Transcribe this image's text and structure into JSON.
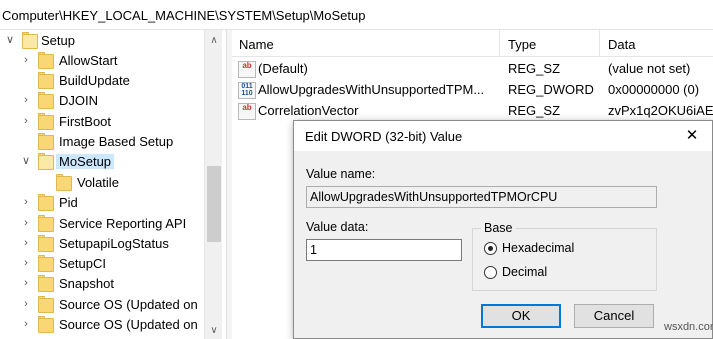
{
  "address": {
    "path": "Computer\\HKEY_LOCAL_MACHINE\\SYSTEM\\Setup\\MoSetup"
  },
  "tree": {
    "items": [
      {
        "label": "Setup",
        "arrow": "∨",
        "open": true,
        "selected": false
      },
      {
        "label": "AllowStart",
        "arrow": "›",
        "open": false,
        "selected": false
      },
      {
        "label": "BuildUpdate",
        "arrow": "",
        "open": false,
        "selected": false
      },
      {
        "label": "DJOIN",
        "arrow": "›",
        "open": false,
        "selected": false
      },
      {
        "label": "FirstBoot",
        "arrow": "›",
        "open": false,
        "selected": false
      },
      {
        "label": "Image Based Setup",
        "arrow": "",
        "open": false,
        "selected": false
      },
      {
        "label": "MoSetup",
        "arrow": "∨",
        "open": true,
        "selected": true
      },
      {
        "label": "Volatile",
        "arrow": "",
        "open": false,
        "selected": false
      },
      {
        "label": "Pid",
        "arrow": "›",
        "open": false,
        "selected": false
      },
      {
        "label": "Service Reporting API",
        "arrow": "›",
        "open": false,
        "selected": false
      },
      {
        "label": "SetupapiLogStatus",
        "arrow": "›",
        "open": false,
        "selected": false
      },
      {
        "label": "SetupCI",
        "arrow": "›",
        "open": false,
        "selected": false
      },
      {
        "label": "Snapshot",
        "arrow": "›",
        "open": false,
        "selected": false
      },
      {
        "label": "Source OS (Updated on",
        "arrow": "›",
        "open": false,
        "selected": false
      },
      {
        "label": "Source OS (Updated on",
        "arrow": "›",
        "open": false,
        "selected": false
      }
    ],
    "scroll_up": "∧",
    "scroll_down": "∨"
  },
  "list": {
    "headers": {
      "name": "Name",
      "type": "Type",
      "data": "Data"
    },
    "rows": [
      {
        "icon": "string-value-icon",
        "name": "(Default)",
        "type": "REG_SZ",
        "data": "(value not set)"
      },
      {
        "icon": "binary-value-icon",
        "name": "AllowUpgradesWithUnsupportedTPM...",
        "type": "REG_DWORD",
        "data": "0x00000000 (0)"
      },
      {
        "icon": "string-value-icon",
        "name": "CorrelationVector",
        "type": "REG_SZ",
        "data": "zvPx1q2OKU6iAE"
      }
    ]
  },
  "dialog": {
    "title": "Edit DWORD (32-bit) Value",
    "close_glyph": "✕",
    "value_name_label": "Value name:",
    "value_name": "AllowUpgradesWithUnsupportedTPMOrCPU",
    "value_data_label": "Value data:",
    "value_data": "1",
    "base_label": "Base",
    "base_options": [
      {
        "label": "Hexadecimal",
        "checked": true
      },
      {
        "label": "Decimal",
        "checked": false
      }
    ],
    "ok_label": "OK",
    "cancel_label": "Cancel"
  },
  "watermark": "wsxdn.com"
}
